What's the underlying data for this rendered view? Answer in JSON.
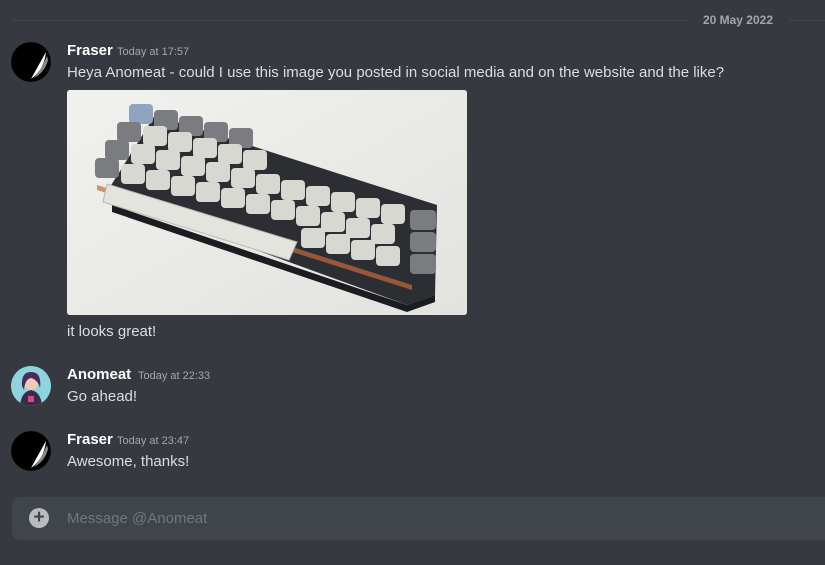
{
  "date_divider": "20 May 2022",
  "messages": [
    {
      "author": "Fraser",
      "timestamp": "Today at 17:57",
      "avatar": "crescent-moon-avatar",
      "lines": [
        "Heya Anomeat - could I use this image you posted in social media and on the website and the like?",
        "it looks great!"
      ],
      "attachment": {
        "type": "image",
        "subject": "keyboard-photo"
      }
    },
    {
      "author": "Anomeat",
      "timestamp": "Today at 22:33",
      "avatar": "illustrated-character-avatar",
      "lines": [
        "Go ahead!"
      ]
    },
    {
      "author": "Fraser",
      "timestamp": "Today at 23:47",
      "avatar": "crescent-moon-avatar",
      "lines": [
        "Awesome, thanks!"
      ]
    }
  ],
  "composer": {
    "placeholder": "Message @Anomeat",
    "attach_icon": "plus-circle-icon"
  },
  "colors": {
    "background": "#36393f",
    "composer": "#40444b",
    "username": "#ffffff",
    "text": "#dcddde",
    "muted": "#a3a6aa",
    "placeholder": "#72767d"
  }
}
